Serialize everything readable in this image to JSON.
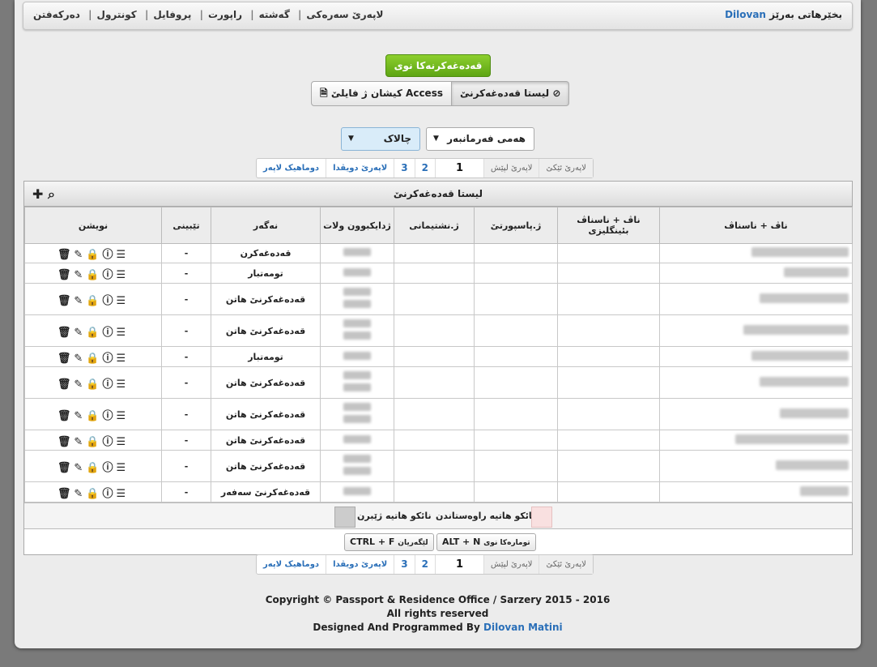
{
  "brand": {
    "prefix": "بخێرهاتی بەرێز",
    "user": "Dilovan"
  },
  "nav": [
    "لاپەرێ سەرەکی",
    "گەشتە",
    "راپورت",
    "پروفایل",
    "کونترول",
    "دەرکەفتن"
  ],
  "new_button": "قەدەغەکرنەکا نوی",
  "tabs": {
    "active": "لیستا قەدەغەکرنێ",
    "import": "کیشان ژ فایلێ Access"
  },
  "filters": {
    "select1": "هەمی فەرمانبەر",
    "select2": "چالاک"
  },
  "pager": {
    "first": "لاپەرێ ئێکێ",
    "prev": "لاپەرێ لپێش",
    "current": "1",
    "p2": "2",
    "p3": "3",
    "next": "لاپەرێ دویڤدا",
    "last": "دوماهیک لاپەر"
  },
  "panel_title": "لیستا قەدەغەکرنێ",
  "columns": [
    "ناڤ + ناسناڤ",
    "ناڤ + ناسناڤ بئینگلیزی",
    "ژ.پاسپورتێ",
    "ژ.نشتیمانی",
    "ژدایکبوون ولات",
    "نەگەر",
    "تێبینی",
    "نویشن"
  ],
  "rows": [
    {
      "reason": "قەدەغەکرن",
      "note": "-"
    },
    {
      "reason": "تومەتبار",
      "note": "-"
    },
    {
      "reason": "قەدەغەکرنێ هاتن",
      "note": "-"
    },
    {
      "reason": "قەدەغەکرنێ هاتن",
      "note": "-"
    },
    {
      "reason": "تومەتبار",
      "note": "-"
    },
    {
      "reason": "قەدەغەکرنێ هاتن",
      "note": "-"
    },
    {
      "reason": "قەدەغەکرنێ هاتن",
      "note": "-"
    },
    {
      "reason": "قەدەغەکرنێ هاتن",
      "note": "-"
    },
    {
      "reason": "قەدەغەکرنێ هاتن",
      "note": "-"
    },
    {
      "reason": "قەدەغەکرنێ سەفەر",
      "note": "-"
    }
  ],
  "legend": {
    "grey": "نائکو هاتیە ژێبرن",
    "pink": "نائکو هاتیە راوەستاندن"
  },
  "shortcuts": {
    "search": "CTRL + F",
    "search_label": "لێگەریان",
    "new": "ALT + N",
    "new_label": "تومارەکا نوی"
  },
  "footer": {
    "line1": "Copyright © Passport & Residence Office / Sarzery 2015 - 2016",
    "line2": "All rights reserved",
    "line3_prefix": "Designed And Programmed By",
    "line3_name": "Dilovan Matini"
  }
}
